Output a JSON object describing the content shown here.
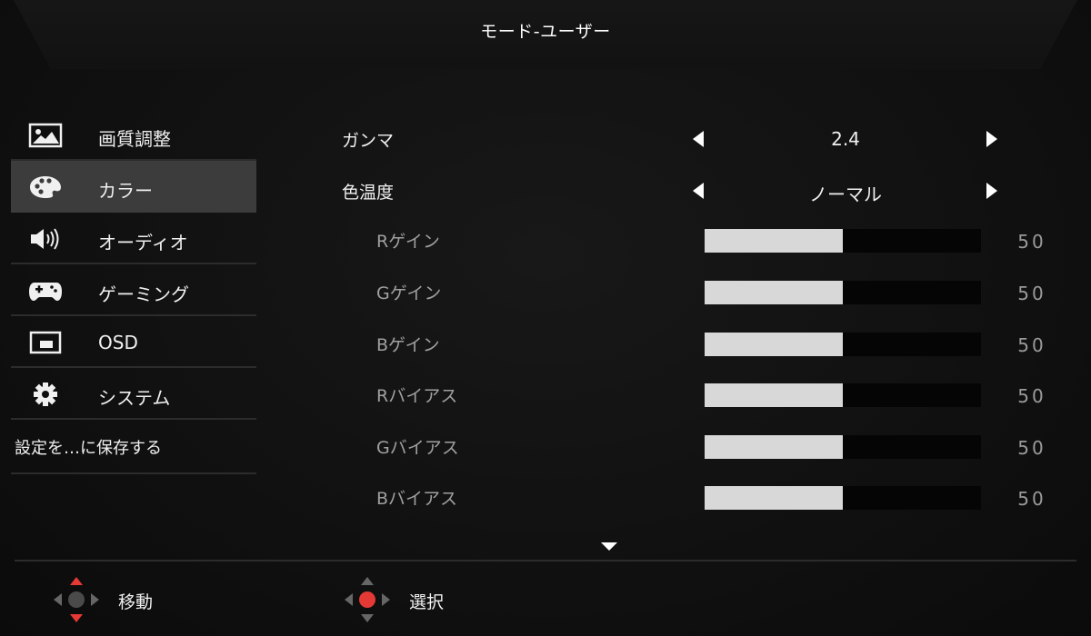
{
  "header": {
    "title": "モード-ユーザー"
  },
  "sidebar": {
    "items": [
      {
        "label": "画質調整",
        "icon": "picture-icon",
        "selected": false
      },
      {
        "label": "カラー",
        "icon": "palette-icon",
        "selected": true
      },
      {
        "label": "オーディオ",
        "icon": "speaker-icon",
        "selected": false
      },
      {
        "label": "ゲーミング",
        "icon": "gamepad-icon",
        "selected": false
      },
      {
        "label": "OSD",
        "icon": "osd-icon",
        "selected": false
      },
      {
        "label": "システム",
        "icon": "gear-icon",
        "selected": false
      }
    ],
    "save_label": "設定を…に保存する"
  },
  "settings": {
    "gamma": {
      "label": "ガンマ",
      "value": "2.4"
    },
    "color_temp": {
      "label": "色温度",
      "value": "ノーマル"
    },
    "gains": [
      {
        "label": "Rゲイン",
        "value": "50",
        "fraction": 0.5
      },
      {
        "label": "Gゲイン",
        "value": "50",
        "fraction": 0.5
      },
      {
        "label": "Bゲイン",
        "value": "50",
        "fraction": 0.5
      },
      {
        "label": "Rバイアス",
        "value": "50",
        "fraction": 0.5
      },
      {
        "label": "Gバイアス",
        "value": "50",
        "fraction": 0.5
      },
      {
        "label": "Bバイアス",
        "value": "50",
        "fraction": 0.5
      }
    ]
  },
  "footer": {
    "move_label": "移動",
    "select_label": "選択"
  },
  "colors": {
    "accent": "#e53935",
    "selected_bg": "#3c3c3c",
    "bar_fill": "#d8d8d8"
  }
}
